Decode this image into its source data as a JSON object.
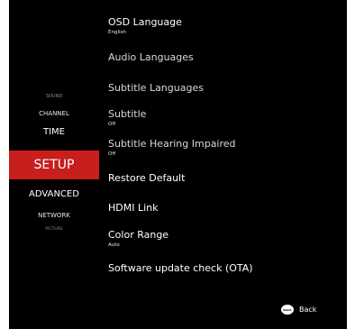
{
  "categories": {
    "sound": "SOUND",
    "channel": "CHANNEL",
    "time": "TIME",
    "setup": "SETUP",
    "advanced": "ADVANCED",
    "network": "NETWORK",
    "picture": "PICTURE"
  },
  "options": [
    {
      "label": "OSD Language",
      "value": "English"
    },
    {
      "label": "Audio Languages"
    },
    {
      "label": "Subtitle Languages"
    },
    {
      "label": "Subtitle",
      "value": "Off"
    },
    {
      "label": "Subtitle Hearing Impaired",
      "value": "Off"
    },
    {
      "label": "Restore Default"
    },
    {
      "label": "HDMI Link"
    },
    {
      "label": "Color Range",
      "value": "Auto"
    },
    {
      "label": "Software update check (OTA)"
    }
  ],
  "footer": {
    "back_icon_text": "BACK",
    "back_label": "Back"
  },
  "colors": {
    "highlight": "#c81e1e",
    "background": "#000000"
  }
}
